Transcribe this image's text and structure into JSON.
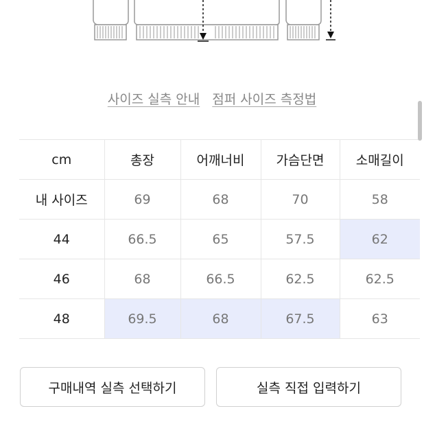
{
  "illustration": {
    "icons": [
      "sleeve-cuff-left",
      "jacket-hem",
      "length-arrow",
      "sleeve-cuff-right",
      "sleeve-length-arrow"
    ]
  },
  "links": {
    "size_guide": "사이즈 실측 안내",
    "jumper_measure": "점퍼 사이즈 측정법"
  },
  "table": {
    "headers": [
      "cm",
      "총장",
      "어깨너비",
      "가슴단면",
      "소매길이"
    ],
    "rows": [
      {
        "label": "내 사이즈",
        "cells": [
          "69",
          "68",
          "70",
          "58"
        ],
        "highlight": [
          false,
          false,
          false,
          false
        ]
      },
      {
        "label": "44",
        "cells": [
          "66.5",
          "65",
          "57.5",
          "62"
        ],
        "highlight": [
          false,
          false,
          false,
          true
        ]
      },
      {
        "label": "46",
        "cells": [
          "68",
          "66.5",
          "62.5",
          "62.5"
        ],
        "highlight": [
          false,
          false,
          false,
          false
        ]
      },
      {
        "label": "48",
        "cells": [
          "69.5",
          "68",
          "67.5",
          "63"
        ],
        "highlight": [
          true,
          true,
          true,
          false
        ]
      }
    ],
    "highlight_color": "#e8ecfc"
  },
  "buttons": {
    "select_purchase": "구매내역 실측 선택하기",
    "direct_input": "실측 직접 입력하기"
  }
}
